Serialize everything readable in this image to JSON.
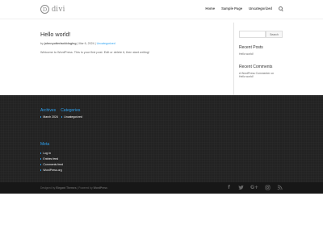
{
  "header": {
    "logo_letter": "D",
    "logo_text": "divi",
    "nav": [
      "Home",
      "Sample Page",
      "Uncategorized"
    ],
    "search_icon": "search-icon"
  },
  "post": {
    "title": "Hello world!",
    "meta_prefix": "by",
    "author": "johnnyotterlackbloging",
    "sep1": "|",
    "date": "Mar 6, 2024",
    "sep2": "|",
    "category": "Uncategorized",
    "body": "Welcome to WordPress. This is your first post. Edit or delete it, then start writing!"
  },
  "sidebar": {
    "search_placeholder": "",
    "search_button": "Search",
    "recent_posts_title": "Recent Posts",
    "recent_posts": [
      "Hello world!"
    ],
    "recent_comments_title": "Recent Comments",
    "recent_comment_line1": "A WordPress Commenter on",
    "recent_comment_line2": "Hello world!"
  },
  "footer": {
    "archives_title": "Archives",
    "categories_title": "Categories",
    "archives": [
      "March 2024"
    ],
    "categories": [
      "Uncategorized"
    ],
    "meta_title": "Meta",
    "meta_items": [
      "Log in",
      "Entries feed",
      "Comments feed",
      "WordPress.org"
    ]
  },
  "bottom": {
    "designed_by_prefix": "Designed by",
    "designer": "Elegant Themes",
    "sep": "|",
    "powered_prefix": "Powered by",
    "powered": "WordPress",
    "social_icons": [
      "facebook-icon",
      "twitter-icon",
      "google-plus-icon",
      "instagram-icon",
      "rss-icon"
    ]
  },
  "colors": {
    "accent": "#2ea3f2",
    "footer_bg": "#222222",
    "bottom_bar_bg": "#171717"
  }
}
